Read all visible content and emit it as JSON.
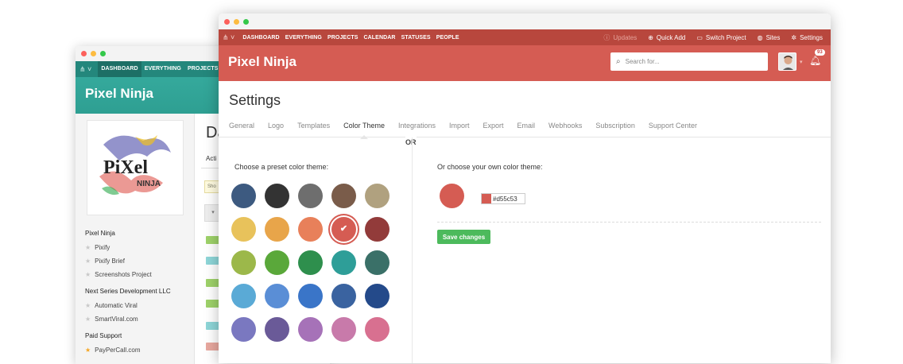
{
  "back_window": {
    "nav": [
      "DASHBOARD",
      "EVERYTHING",
      "PROJECTS"
    ],
    "brand": "Pixel Ninja",
    "heading_partial": "Da",
    "tab_partial": "Acti",
    "notice_partial": "Sho",
    "logo_text": "PiXel",
    "logo_subtext": "NINJA",
    "sidebar": {
      "groups": [
        {
          "title": "Pixel Ninja",
          "items": [
            {
              "label": "Pixify",
              "starred": false
            },
            {
              "label": "Pixify Brief",
              "starred": false
            },
            {
              "label": "Screenshots Project",
              "starred": false
            }
          ]
        },
        {
          "title": "Next Series Development LLC",
          "items": [
            {
              "label": "Automatic Viral",
              "starred": false
            },
            {
              "label": "SmartViral.com",
              "starred": false
            }
          ]
        },
        {
          "title": "Paid Support",
          "items": [
            {
              "label": "PayPerCall.com",
              "starred": true
            }
          ]
        }
      ]
    },
    "chip_colors": [
      "#9ed26a",
      "#8ed6d8",
      "#9ed26a",
      "#9ed26a",
      "#8ed6d8",
      "#e8a89f"
    ]
  },
  "front_window": {
    "nav": [
      "DASHBOARD",
      "EVERYTHING",
      "PROJECTS",
      "CALENDAR",
      "STATUSES",
      "PEOPLE"
    ],
    "nav_right": [
      {
        "label": "Updates",
        "icon": "info-icon"
      },
      {
        "label": "Quick Add",
        "icon": "plus-circle-icon"
      },
      {
        "label": "Switch Project",
        "icon": "switch-icon"
      },
      {
        "label": "Sites",
        "icon": "globe-icon"
      },
      {
        "label": "Settings",
        "icon": "gear-icon"
      }
    ],
    "brand": "Pixel Ninja",
    "search_placeholder": "Search for...",
    "notification_count": "93",
    "page_title": "Settings",
    "tabs": [
      "General",
      "Logo",
      "Templates",
      "Color Theme",
      "Integrations",
      "Import",
      "Export",
      "Email",
      "Webhooks",
      "Subscription",
      "Support Center"
    ],
    "active_tab": "Color Theme",
    "preset_label": "Choose a preset color theme:",
    "or_label": "OR",
    "own_label": "Or choose your own color theme:",
    "hex_value": "#d55c53",
    "save_label": "Save changes",
    "selected_swatch": "#d55c53",
    "swatch_rows": [
      [
        "#3d5a80",
        "#333333",
        "#6e6e6e",
        "#7a5c4a",
        "#b0a17f"
      ],
      [
        "#e8c25b",
        "#e8a54a",
        "#e8805a",
        "#d55c53",
        "#923b3a"
      ],
      [
        "#9cb84a",
        "#5aa83a",
        "#2e8f4d",
        "#2e9e98",
        "#3a7068"
      ],
      [
        "#5aaad6",
        "#5a8ed6",
        "#3a75c8",
        "#3a63a0",
        "#244a8a"
      ],
      [
        "#7a78c0",
        "#6a5a98",
        "#a672b8",
        "#c87aaa",
        "#d87090"
      ]
    ]
  }
}
